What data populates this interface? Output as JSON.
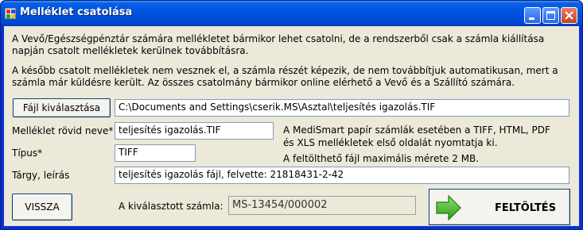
{
  "window": {
    "title": "Melléklet csatolása"
  },
  "info": {
    "paragraph1_line1": "A Vevő/Egészségpénztár számára mellékletet bármikor lehet csatolni, de a rendszerből csak a számla kiállítása",
    "paragraph1_line2": "napján csatolt mellékletek kerülnek továbbításra.",
    "paragraph2_line1": "A később csatolt mellékletek nem vesznek el, a számla részét képezik, de nem továbbítjuk automatikusan, mert a",
    "paragraph2_line2": "számla már küldésre került. Az összes csatolmány bármikor online elérhető a Vevő és a Szállító számára."
  },
  "file": {
    "button_label": "Fájl kiválasztása",
    "path_value": "C:\\Documents and Settings\\cserik.MS\\Asztal\\teljesítés igazolás.TIF"
  },
  "short_name": {
    "label": "Melléklet rövid neve*",
    "value": "teljesítés igazolás.TIF"
  },
  "type": {
    "label": "Típus*",
    "value": "TIFF"
  },
  "note": {
    "line1": "A MediSmart papír számlák esetében a TIFF, HTML, PDF",
    "line2": "és XLS mellékletek első oldalát nyomtatja ki.",
    "line3": "A feltölthető fájl maximális mérete 2 MB."
  },
  "subject": {
    "label": "Tárgy, leírás",
    "value": "teljesítés igazolás fájl, felvette: 21818431-2-42"
  },
  "back_button": {
    "label": "VISSZA"
  },
  "selected_invoice": {
    "label": "A kiválasztott számla:",
    "value": "MS-13454/000002"
  },
  "upload_button": {
    "label": "FELTÖLTÉS",
    "icon": "green-arrow-right-icon"
  },
  "colors": {
    "title_bar": "#0053e1",
    "client_bg": "#ece9d8",
    "arrow_green": "#3cb02a"
  }
}
